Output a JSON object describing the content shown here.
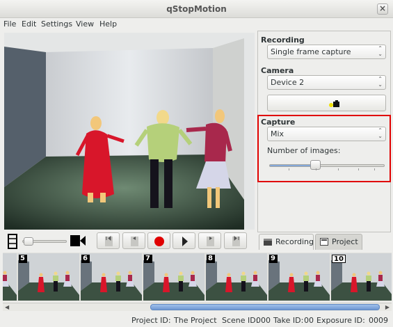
{
  "window": {
    "title": "qStopMotion",
    "close_glyph": "×"
  },
  "menu": [
    "File",
    "Edit",
    "Settings",
    "View",
    "Help"
  ],
  "recording": {
    "group_title": "Recording",
    "mode_value": "Single frame capture",
    "camera_title": "Camera",
    "device_value": "Device 2"
  },
  "capture": {
    "group_title": "Capture",
    "mode_value": "Mix",
    "images_label": "Number of images:",
    "slider_fraction": 0.4
  },
  "tabs": [
    {
      "label": "Recording",
      "active": true
    },
    {
      "label": "Project",
      "active": false
    }
  ],
  "filmstrip": {
    "frames": [
      {
        "number": "5"
      },
      {
        "number": "6"
      },
      {
        "number": "7"
      },
      {
        "number": "8"
      },
      {
        "number": "9"
      },
      {
        "number": "10"
      }
    ]
  },
  "status": {
    "project_label": "Project ID:",
    "project_value": "The Project",
    "scene_label": "Scene ID:",
    "scene_value": "000",
    "take_label": "Take ID:",
    "take_value": "00",
    "exposure_label": "Exposure ID:",
    "exposure_value": "0009"
  },
  "colors": {
    "accent": "#e00000",
    "record": "#e00000",
    "slider_fill": "#84a8d8"
  },
  "icons": {
    "film": "film-icon",
    "video_camera": "video-camera-icon",
    "first": "skip-first-icon",
    "previous": "previous-frame-icon",
    "record": "record-icon",
    "play": "play-icon",
    "next": "next-frame-icon",
    "last": "skip-last-icon",
    "webcam": "webcam-icon"
  }
}
